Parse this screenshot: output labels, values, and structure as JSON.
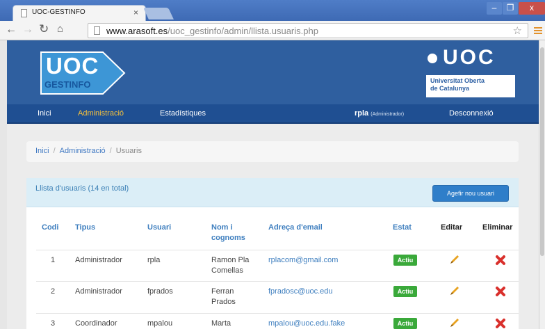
{
  "browser": {
    "tab_title": "UOC-GESTINFO",
    "tab_close": "×",
    "url_host": "www.arasoft.es",
    "url_path": "/uoc_gestinfo/admin/llista.usuaris.php",
    "window_buttons": {
      "minimize": "–",
      "maximize": "❐",
      "close": "x"
    }
  },
  "header": {
    "logo_main": "UOC",
    "logo_sub": "GESTINFO",
    "uoc_brand": "UOC",
    "uoc_line1": "Universitat Oberta",
    "uoc_line2": "de Catalunya"
  },
  "nav": {
    "items": [
      {
        "label": "Inici",
        "active": false
      },
      {
        "label": "Administració",
        "active": true
      },
      {
        "label": "Estadístiques",
        "active": false
      }
    ],
    "user": "rpla",
    "role": "(Administrador)",
    "logout": "Desconnexió"
  },
  "breadcrumb": [
    "Inici",
    "Administració",
    "Usuaris"
  ],
  "panel": {
    "title": "Llista d'usuaris (14 en total)",
    "add_button": "Agefir nou usuari"
  },
  "table": {
    "headers": [
      "Codi",
      "Tipus",
      "Usuari",
      "Nom i cognoms",
      "Adreça d'email",
      "Estat",
      "Editar",
      "Eliminar"
    ],
    "rows": [
      {
        "code": "1",
        "type": "Administrador",
        "user": "rpla",
        "name": "Ramon Pla Comellas",
        "email": "rplacom@gmail.com",
        "status": "Actiu"
      },
      {
        "code": "2",
        "type": "Administrador",
        "user": "fprados",
        "name": "Ferran Prados",
        "email": "fpradosc@uoc.edu",
        "status": "Actiu"
      },
      {
        "code": "3",
        "type": "Coordinador",
        "user": "mpalou",
        "name": "Marta",
        "email": "mpalou@uoc.edu.fake",
        "status": "Actiu"
      }
    ]
  },
  "colors": {
    "header_blue": "#2f5f9f",
    "nav_blue": "#1f4f92",
    "active_nav": "#f5c13c",
    "link_blue": "#3f7fbf",
    "badge_green": "#3aa93a",
    "delete_red": "#d9302c",
    "edit_orange": "#e8a21f"
  }
}
